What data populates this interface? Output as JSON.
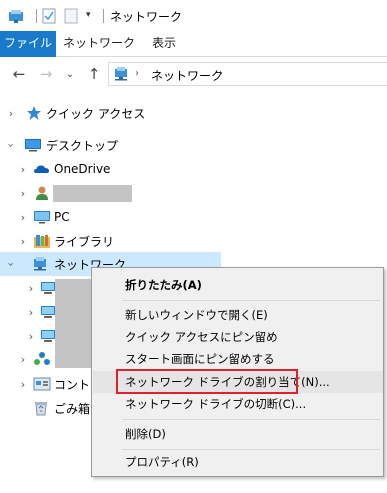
{
  "window": {
    "title": "ネットワーク"
  },
  "ribbon": {
    "tabs": [
      "ファイル",
      "ネットワーク",
      "表示"
    ]
  },
  "address": {
    "path": "ネットワーク",
    "separator": "›"
  },
  "tree": {
    "items": [
      {
        "label": "クイック アクセス",
        "icon": "star-icon"
      },
      {
        "label": "デスクトップ",
        "icon": "desktop-icon"
      },
      {
        "label": "OneDrive",
        "icon": "onedrive-cloud-icon"
      },
      {
        "label": "",
        "icon": "user-icon"
      },
      {
        "label": "PC",
        "icon": "pc-icon"
      },
      {
        "label": "ライブラリ",
        "icon": "library-icon"
      },
      {
        "label": "ネットワーク",
        "icon": "network-icon"
      },
      {
        "label": "",
        "icon": "computer-icon"
      },
      {
        "label": "",
        "icon": "computer-icon"
      },
      {
        "label": "",
        "icon": "computer-icon"
      },
      {
        "label": "",
        "icon": "homegroup-icon"
      },
      {
        "label": "コントロ",
        "icon": "control-panel-icon"
      },
      {
        "label": "ごみ箱",
        "icon": "recycle-bin-icon"
      }
    ]
  },
  "context_menu": {
    "items": [
      "折りたたみ(A)",
      "新しいウィンドウで開く(E)",
      "クイック アクセスにピン留め",
      "スタート画面にピン留めする",
      "ネットワーク ドライブの割り当て(N)...",
      "ネットワーク ドライブの切断(C)...",
      "削除(D)",
      "プロパティ(R)"
    ]
  },
  "colors": {
    "accent": "#1979ca",
    "selection": "#cce8ff",
    "highlight_box": "#e0202a"
  }
}
